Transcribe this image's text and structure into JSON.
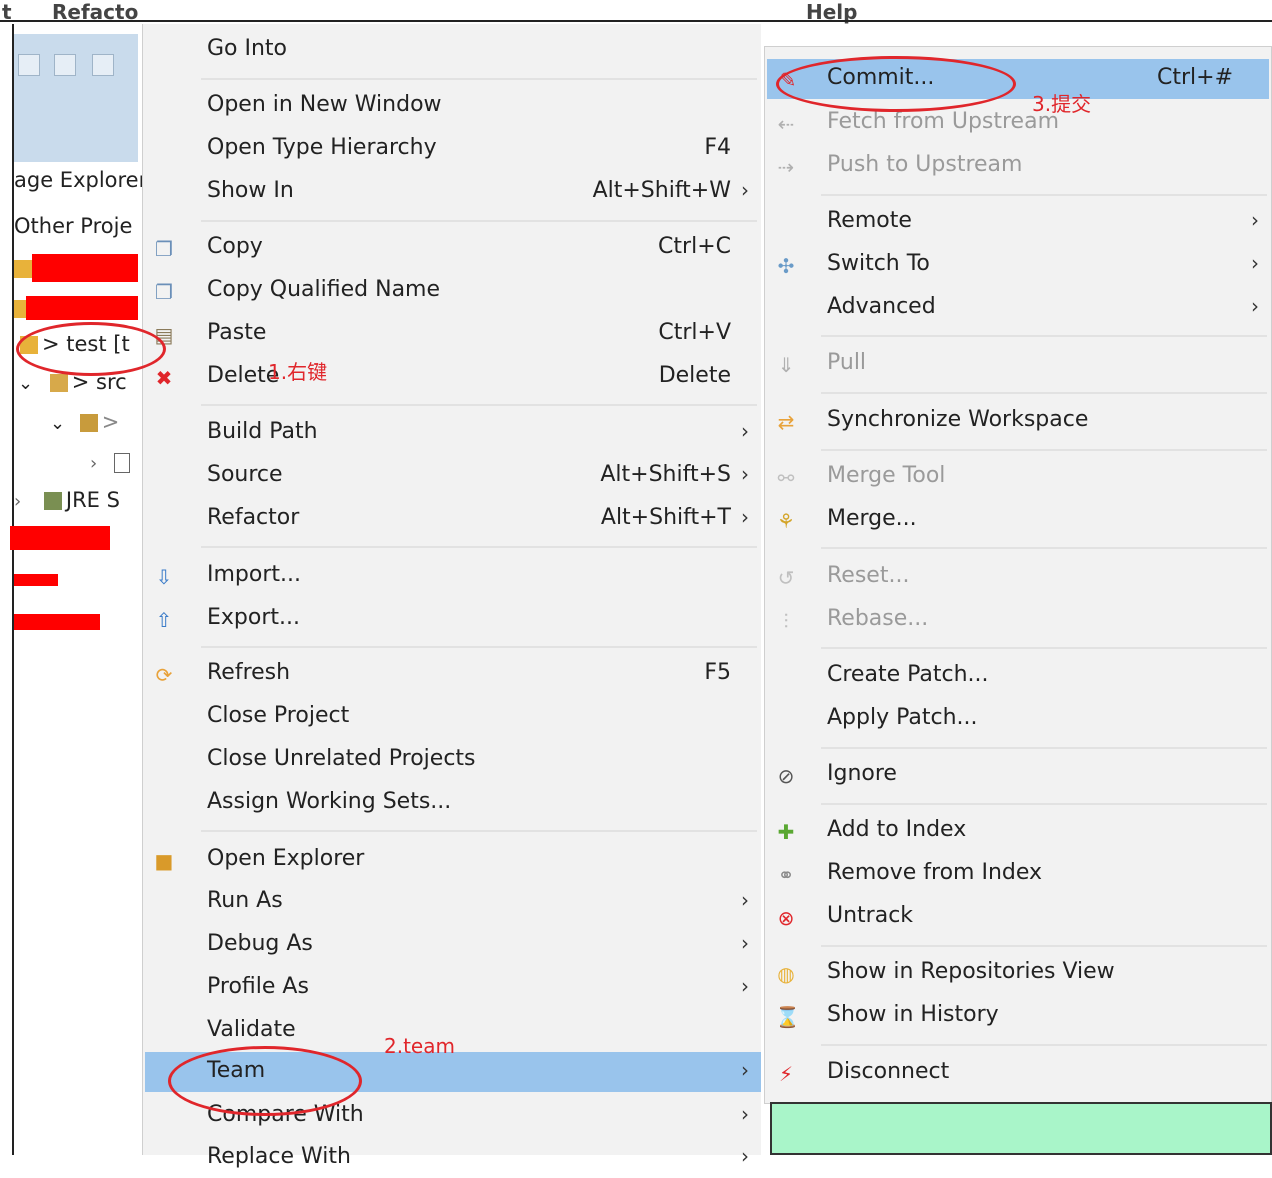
{
  "menubar": {
    "left_label": "Refacto",
    "right_label": "Help",
    "left_stub": "t"
  },
  "explorer": {
    "title": "age Explorer",
    "other": "Other Proje",
    "project": "> test [t",
    "src": "> src",
    "jre": "JRE S"
  },
  "menu": [
    {
      "id": "go-into",
      "label": "Go Into",
      "accel": ""
    },
    {
      "id": "open-new-window",
      "label": "Open in New Window",
      "accel": ""
    },
    {
      "id": "open-type-hierarchy",
      "label": "Open Type Hierarchy",
      "accel": "F4"
    },
    {
      "id": "show-in",
      "label": "Show In",
      "accel": "Alt+Shift+W",
      "submenu": true
    },
    {
      "id": "copy",
      "label": "Copy",
      "accel": "Ctrl+C"
    },
    {
      "id": "copy-qualified-name",
      "label": "Copy Qualified Name",
      "accel": ""
    },
    {
      "id": "paste",
      "label": "Paste",
      "accel": "Ctrl+V"
    },
    {
      "id": "delete",
      "label": "Delete",
      "accel": "Delete"
    },
    {
      "id": "build-path",
      "label": "Build Path",
      "accel": "",
      "submenu": true
    },
    {
      "id": "source",
      "label": "Source",
      "accel": "Alt+Shift+S",
      "submenu": true
    },
    {
      "id": "refactor",
      "label": "Refactor",
      "accel": "Alt+Shift+T",
      "submenu": true
    },
    {
      "id": "import",
      "label": "Import...",
      "accel": ""
    },
    {
      "id": "export",
      "label": "Export...",
      "accel": ""
    },
    {
      "id": "refresh",
      "label": "Refresh",
      "accel": "F5"
    },
    {
      "id": "close-project",
      "label": "Close Project",
      "accel": ""
    },
    {
      "id": "close-unrelated",
      "label": "Close Unrelated Projects",
      "accel": ""
    },
    {
      "id": "assign-working-sets",
      "label": "Assign Working Sets...",
      "accel": ""
    },
    {
      "id": "open-explorer",
      "label": "Open Explorer",
      "accel": ""
    },
    {
      "id": "run-as",
      "label": "Run As",
      "accel": "",
      "submenu": true
    },
    {
      "id": "debug-as",
      "label": "Debug As",
      "accel": "",
      "submenu": true
    },
    {
      "id": "profile-as",
      "label": "Profile As",
      "accel": "",
      "submenu": true
    },
    {
      "id": "validate",
      "label": "Validate",
      "accel": ""
    },
    {
      "id": "team",
      "label": "Team",
      "accel": "",
      "submenu": true
    },
    {
      "id": "compare-with",
      "label": "Compare With",
      "accel": "",
      "submenu": true
    },
    {
      "id": "replace-with",
      "label": "Replace With",
      "accel": "",
      "submenu": true
    }
  ],
  "team_menu": [
    {
      "id": "commit",
      "label": "Commit...",
      "accel": "Ctrl+#"
    },
    {
      "id": "fetch-upstream",
      "label": "Fetch from Upstream",
      "accel": ""
    },
    {
      "id": "push-upstream",
      "label": "Push to Upstream",
      "accel": ""
    },
    {
      "id": "remote",
      "label": "Remote",
      "accel": "",
      "submenu": true
    },
    {
      "id": "switch-to",
      "label": "Switch To",
      "accel": "",
      "submenu": true
    },
    {
      "id": "advanced",
      "label": "Advanced",
      "accel": "",
      "submenu": true
    },
    {
      "id": "pull",
      "label": "Pull",
      "accel": ""
    },
    {
      "id": "synchronize-workspace",
      "label": "Synchronize Workspace",
      "accel": ""
    },
    {
      "id": "merge-tool",
      "label": "Merge Tool",
      "accel": ""
    },
    {
      "id": "merge",
      "label": "Merge...",
      "accel": ""
    },
    {
      "id": "reset",
      "label": "Reset...",
      "accel": ""
    },
    {
      "id": "rebase",
      "label": "Rebase...",
      "accel": ""
    },
    {
      "id": "create-patch",
      "label": "Create Patch...",
      "accel": ""
    },
    {
      "id": "apply-patch",
      "label": "Apply Patch...",
      "accel": ""
    },
    {
      "id": "ignore",
      "label": "Ignore",
      "accel": ""
    },
    {
      "id": "add-to-index",
      "label": "Add to Index",
      "accel": ""
    },
    {
      "id": "remove-from-index",
      "label": "Remove from Index",
      "accel": ""
    },
    {
      "id": "untrack",
      "label": "Untrack",
      "accel": ""
    },
    {
      "id": "show-repositories-view",
      "label": "Show in Repositories View",
      "accel": ""
    },
    {
      "id": "show-history",
      "label": "Show in History",
      "accel": ""
    },
    {
      "id": "disconnect",
      "label": "Disconnect",
      "accel": ""
    }
  ],
  "annotations": {
    "step1": "1.右键",
    "step2": "2.team",
    "step3": "3.提交"
  },
  "colors": {
    "selection": "#99c4ec",
    "annotation": "#e0262b",
    "menu_bg": "#f2f2f2"
  }
}
